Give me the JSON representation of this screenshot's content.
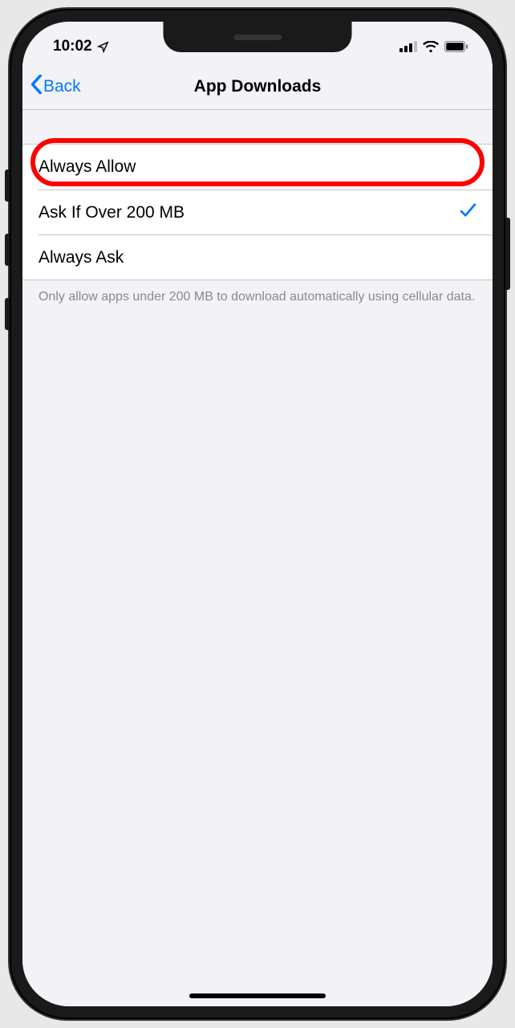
{
  "status": {
    "time": "10:02",
    "location_icon": "location-arrow",
    "signal": "cellular-3-of-4",
    "wifi": "wifi-full",
    "battery": "battery-full"
  },
  "nav": {
    "back_label": "Back",
    "title": "App Downloads"
  },
  "options": [
    {
      "label": "Always Allow",
      "selected": false,
      "highlighted": true
    },
    {
      "label": "Ask If Over 200 MB",
      "selected": true,
      "highlighted": false
    },
    {
      "label": "Always Ask",
      "selected": false,
      "highlighted": false
    }
  ],
  "footer": "Only allow apps under 200 MB to download automatically using cellular data.",
  "colors": {
    "tint": "#007aff",
    "highlight": "#ff0000",
    "background": "#f2f2f7"
  }
}
